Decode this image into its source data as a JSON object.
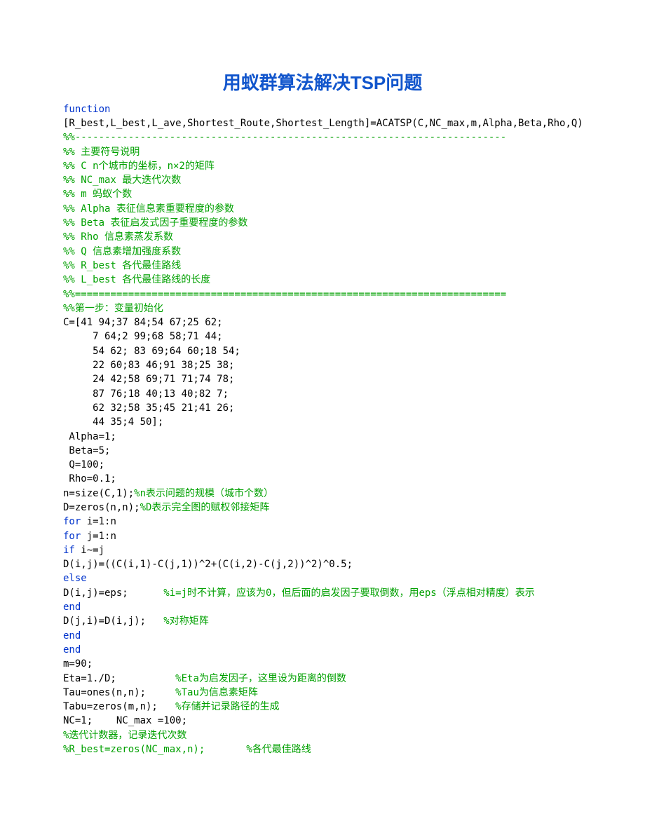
{
  "title": "用蚁群算法解决TSP问题",
  "lines": [
    {
      "parts": [
        {
          "cls": "kw",
          "t": "function"
        }
      ]
    },
    {
      "parts": [
        {
          "cls": "txt",
          "t": "[R_best,L_best,L_ave,Shortest_Route,Shortest_Length]=ACATSP(C,NC_max,m,Alpha,Beta,Rho,Q)"
        }
      ]
    },
    {
      "parts": [
        {
          "cls": "cm",
          "t": "%%-------------------------------------------------------------------------"
        }
      ]
    },
    {
      "parts": [
        {
          "cls": "cm",
          "t": "%% 主要符号说明"
        }
      ]
    },
    {
      "parts": [
        {
          "cls": "cm",
          "t": "%% C n个城市的坐标，n×2的矩阵"
        }
      ]
    },
    {
      "parts": [
        {
          "cls": "cm",
          "t": "%% NC_max 最大迭代次数"
        }
      ]
    },
    {
      "parts": [
        {
          "cls": "cm",
          "t": "%% m 蚂蚁个数"
        }
      ]
    },
    {
      "parts": [
        {
          "cls": "cm",
          "t": "%% Alpha 表征信息素重要程度的参数"
        }
      ]
    },
    {
      "parts": [
        {
          "cls": "cm",
          "t": "%% Beta 表征启发式因子重要程度的参数"
        }
      ]
    },
    {
      "parts": [
        {
          "cls": "cm",
          "t": "%% Rho 信息素蒸发系数"
        }
      ]
    },
    {
      "parts": [
        {
          "cls": "cm",
          "t": "%% Q 信息素增加强度系数"
        }
      ]
    },
    {
      "parts": [
        {
          "cls": "cm",
          "t": "%% R_best 各代最佳路线"
        }
      ]
    },
    {
      "parts": [
        {
          "cls": "cm",
          "t": "%% L_best 各代最佳路线的长度"
        }
      ]
    },
    {
      "parts": [
        {
          "cls": "cm",
          "t": "%%========================================================================="
        }
      ]
    },
    {
      "parts": [
        {
          "cls": "cm",
          "t": "%%第一步：变量初始化"
        }
      ]
    },
    {
      "parts": [
        {
          "cls": "txt",
          "t": "C=[41 94;37 84;54 67;25 62;"
        }
      ]
    },
    {
      "parts": [
        {
          "cls": "txt",
          "t": "     7 64;2 99;68 58;71 44;"
        }
      ]
    },
    {
      "parts": [
        {
          "cls": "txt",
          "t": "     54 62; 83 69;64 60;18 54;"
        }
      ]
    },
    {
      "parts": [
        {
          "cls": "txt",
          "t": "     22 60;83 46;91 38;25 38;"
        }
      ]
    },
    {
      "parts": [
        {
          "cls": "txt",
          "t": "     24 42;58 69;71 71;74 78;"
        }
      ]
    },
    {
      "parts": [
        {
          "cls": "txt",
          "t": "     87 76;18 40;13 40;82 7;"
        }
      ]
    },
    {
      "parts": [
        {
          "cls": "txt",
          "t": "     62 32;58 35;45 21;41 26;"
        }
      ]
    },
    {
      "parts": [
        {
          "cls": "txt",
          "t": "     44 35;4 50];"
        }
      ]
    },
    {
      "parts": [
        {
          "cls": "txt",
          "t": " Alpha=1;"
        }
      ]
    },
    {
      "parts": [
        {
          "cls": "txt",
          "t": " Beta=5;"
        }
      ]
    },
    {
      "parts": [
        {
          "cls": "txt",
          "t": " Q=100;"
        }
      ]
    },
    {
      "parts": [
        {
          "cls": "txt",
          "t": " Rho=0.1;"
        }
      ]
    },
    {
      "parts": [
        {
          "cls": "txt",
          "t": "n=size(C,1);"
        },
        {
          "cls": "cm",
          "t": "%n表示问题的规模（城市个数）"
        }
      ]
    },
    {
      "parts": [
        {
          "cls": "txt",
          "t": "D=zeros(n,n);"
        },
        {
          "cls": "cm",
          "t": "%D表示完全图的赋权邻接矩阵"
        }
      ]
    },
    {
      "parts": [
        {
          "cls": "kw",
          "t": "for"
        },
        {
          "cls": "txt",
          "t": " i=1:n"
        }
      ]
    },
    {
      "parts": [
        {
          "cls": "kw",
          "t": "for"
        },
        {
          "cls": "txt",
          "t": " j=1:n"
        }
      ]
    },
    {
      "parts": [
        {
          "cls": "kw",
          "t": "if"
        },
        {
          "cls": "txt",
          "t": " i~=j"
        }
      ]
    },
    {
      "parts": [
        {
          "cls": "txt",
          "t": "D(i,j)=((C(i,1)-C(j,1))^2+(C(i,2)-C(j,2))^2)^0.5;"
        }
      ]
    },
    {
      "parts": [
        {
          "cls": "kw",
          "t": "else"
        }
      ]
    },
    {
      "parts": [
        {
          "cls": "txt",
          "t": "D(i,j)=eps;      "
        },
        {
          "cls": "cm",
          "t": "%i=j时不计算，应该为0，但后面的启发因子要取倒数，用eps（浮点相对精度）表示"
        }
      ]
    },
    {
      "parts": [
        {
          "cls": "kw",
          "t": "end"
        }
      ]
    },
    {
      "parts": [
        {
          "cls": "txt",
          "t": "D(j,i)=D(i,j);   "
        },
        {
          "cls": "cm",
          "t": "%对称矩阵"
        }
      ]
    },
    {
      "parts": [
        {
          "cls": "kw",
          "t": "end"
        }
      ]
    },
    {
      "parts": [
        {
          "cls": "kw",
          "t": "end"
        }
      ]
    },
    {
      "parts": [
        {
          "cls": "txt",
          "t": "m=90;"
        }
      ]
    },
    {
      "parts": [
        {
          "cls": "txt",
          "t": "Eta=1./D;          "
        },
        {
          "cls": "cm",
          "t": "%Eta为启发因子，这里设为距离的倒数"
        }
      ]
    },
    {
      "parts": [
        {
          "cls": "txt",
          "t": "Tau=ones(n,n);     "
        },
        {
          "cls": "cm",
          "t": "%Tau为信息素矩阵"
        }
      ]
    },
    {
      "parts": [
        {
          "cls": "txt",
          "t": "Tabu=zeros(m,n);   "
        },
        {
          "cls": "cm",
          "t": "%存储并记录路径的生成"
        }
      ]
    },
    {
      "parts": [
        {
          "cls": "txt",
          "t": "NC=1;    NC_max =100;"
        }
      ]
    },
    {
      "parts": [
        {
          "cls": "cm",
          "t": "%迭代计数器，记录迭代次数"
        }
      ]
    },
    {
      "parts": [
        {
          "cls": "cm",
          "t": "%R_best=zeros(NC_max,n);       %各代最佳路线"
        }
      ]
    }
  ]
}
